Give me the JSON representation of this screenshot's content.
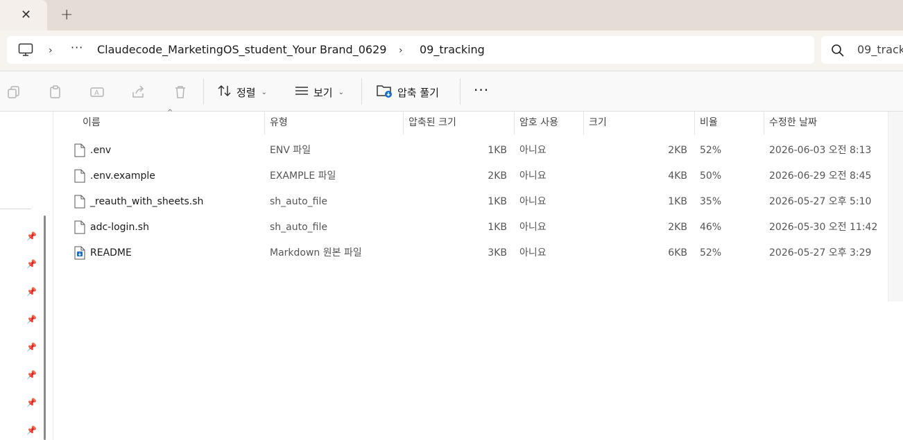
{
  "tabbar": {
    "close_glyph": "✕",
    "new_tab_glyph": "+"
  },
  "address": {
    "more_glyph": "···",
    "crumbs": [
      "Claudecode_MarketingOS_student_Your Brand_0629",
      "09_tracking"
    ],
    "chevron": "›"
  },
  "search": {
    "value": "09_track"
  },
  "toolbar": {
    "sort_label": "정렬",
    "view_label": "보기",
    "extract_label": "압축 풀기",
    "more_glyph": "···",
    "chevron": "⌄"
  },
  "columns": {
    "name": "이름",
    "type": "유형",
    "compressed": "압축된 크기",
    "password": "암호 사용",
    "size": "크기",
    "ratio": "비율",
    "modified": "수정한 날짜"
  },
  "files": [
    {
      "name": ".env",
      "type": "ENV 파일",
      "compressed": "1KB",
      "password": "아니요",
      "size": "2KB",
      "ratio": "52%",
      "modified": "2026-06-03 오전 8:13",
      "icon": "file-icon"
    },
    {
      "name": ".env.example",
      "type": "EXAMPLE 파일",
      "compressed": "2KB",
      "password": "아니요",
      "size": "4KB",
      "ratio": "50%",
      "modified": "2026-06-29 오전 8:45",
      "icon": "file-icon"
    },
    {
      "name": "_reauth_with_sheets.sh",
      "type": "sh_auto_file",
      "compressed": "1KB",
      "password": "아니요",
      "size": "1KB",
      "ratio": "35%",
      "modified": "2026-05-27 오후 5:10",
      "icon": "file-icon"
    },
    {
      "name": "adc-login.sh",
      "type": "sh_auto_file",
      "compressed": "1KB",
      "password": "아니요",
      "size": "2KB",
      "ratio": "46%",
      "modified": "2026-05-30 오전 11:42",
      "icon": "file-icon"
    },
    {
      "name": "README",
      "type": "Markdown 원본 파일",
      "compressed": "3KB",
      "password": "아니요",
      "size": "6KB",
      "ratio": "52%",
      "modified": "2026-05-27 오후 3:29",
      "icon": "markdown-file-icon"
    }
  ],
  "colors": {
    "tabbar_bg": "#e5ddd5",
    "toolbar_bg": "#f9f9f9",
    "accent_blue": "#1a6fc4"
  }
}
